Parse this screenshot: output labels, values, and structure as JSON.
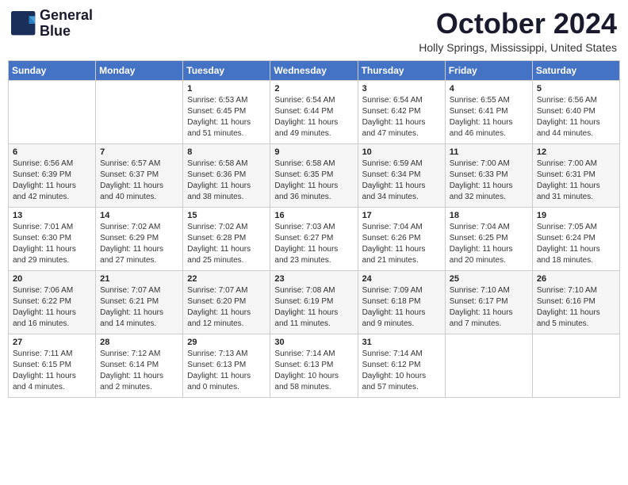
{
  "header": {
    "logo_line1": "General",
    "logo_line2": "Blue",
    "month_title": "October 2024",
    "location": "Holly Springs, Mississippi, United States"
  },
  "weekdays": [
    "Sunday",
    "Monday",
    "Tuesday",
    "Wednesday",
    "Thursday",
    "Friday",
    "Saturday"
  ],
  "weeks": [
    [
      {
        "day": "",
        "info": ""
      },
      {
        "day": "",
        "info": ""
      },
      {
        "day": "1",
        "info": "Sunrise: 6:53 AM\nSunset: 6:45 PM\nDaylight: 11 hours and 51 minutes."
      },
      {
        "day": "2",
        "info": "Sunrise: 6:54 AM\nSunset: 6:44 PM\nDaylight: 11 hours and 49 minutes."
      },
      {
        "day": "3",
        "info": "Sunrise: 6:54 AM\nSunset: 6:42 PM\nDaylight: 11 hours and 47 minutes."
      },
      {
        "day": "4",
        "info": "Sunrise: 6:55 AM\nSunset: 6:41 PM\nDaylight: 11 hours and 46 minutes."
      },
      {
        "day": "5",
        "info": "Sunrise: 6:56 AM\nSunset: 6:40 PM\nDaylight: 11 hours and 44 minutes."
      }
    ],
    [
      {
        "day": "6",
        "info": "Sunrise: 6:56 AM\nSunset: 6:39 PM\nDaylight: 11 hours and 42 minutes."
      },
      {
        "day": "7",
        "info": "Sunrise: 6:57 AM\nSunset: 6:37 PM\nDaylight: 11 hours and 40 minutes."
      },
      {
        "day": "8",
        "info": "Sunrise: 6:58 AM\nSunset: 6:36 PM\nDaylight: 11 hours and 38 minutes."
      },
      {
        "day": "9",
        "info": "Sunrise: 6:58 AM\nSunset: 6:35 PM\nDaylight: 11 hours and 36 minutes."
      },
      {
        "day": "10",
        "info": "Sunrise: 6:59 AM\nSunset: 6:34 PM\nDaylight: 11 hours and 34 minutes."
      },
      {
        "day": "11",
        "info": "Sunrise: 7:00 AM\nSunset: 6:33 PM\nDaylight: 11 hours and 32 minutes."
      },
      {
        "day": "12",
        "info": "Sunrise: 7:00 AM\nSunset: 6:31 PM\nDaylight: 11 hours and 31 minutes."
      }
    ],
    [
      {
        "day": "13",
        "info": "Sunrise: 7:01 AM\nSunset: 6:30 PM\nDaylight: 11 hours and 29 minutes."
      },
      {
        "day": "14",
        "info": "Sunrise: 7:02 AM\nSunset: 6:29 PM\nDaylight: 11 hours and 27 minutes."
      },
      {
        "day": "15",
        "info": "Sunrise: 7:02 AM\nSunset: 6:28 PM\nDaylight: 11 hours and 25 minutes."
      },
      {
        "day": "16",
        "info": "Sunrise: 7:03 AM\nSunset: 6:27 PM\nDaylight: 11 hours and 23 minutes."
      },
      {
        "day": "17",
        "info": "Sunrise: 7:04 AM\nSunset: 6:26 PM\nDaylight: 11 hours and 21 minutes."
      },
      {
        "day": "18",
        "info": "Sunrise: 7:04 AM\nSunset: 6:25 PM\nDaylight: 11 hours and 20 minutes."
      },
      {
        "day": "19",
        "info": "Sunrise: 7:05 AM\nSunset: 6:24 PM\nDaylight: 11 hours and 18 minutes."
      }
    ],
    [
      {
        "day": "20",
        "info": "Sunrise: 7:06 AM\nSunset: 6:22 PM\nDaylight: 11 hours and 16 minutes."
      },
      {
        "day": "21",
        "info": "Sunrise: 7:07 AM\nSunset: 6:21 PM\nDaylight: 11 hours and 14 minutes."
      },
      {
        "day": "22",
        "info": "Sunrise: 7:07 AM\nSunset: 6:20 PM\nDaylight: 11 hours and 12 minutes."
      },
      {
        "day": "23",
        "info": "Sunrise: 7:08 AM\nSunset: 6:19 PM\nDaylight: 11 hours and 11 minutes."
      },
      {
        "day": "24",
        "info": "Sunrise: 7:09 AM\nSunset: 6:18 PM\nDaylight: 11 hours and 9 minutes."
      },
      {
        "day": "25",
        "info": "Sunrise: 7:10 AM\nSunset: 6:17 PM\nDaylight: 11 hours and 7 minutes."
      },
      {
        "day": "26",
        "info": "Sunrise: 7:10 AM\nSunset: 6:16 PM\nDaylight: 11 hours and 5 minutes."
      }
    ],
    [
      {
        "day": "27",
        "info": "Sunrise: 7:11 AM\nSunset: 6:15 PM\nDaylight: 11 hours and 4 minutes."
      },
      {
        "day": "28",
        "info": "Sunrise: 7:12 AM\nSunset: 6:14 PM\nDaylight: 11 hours and 2 minutes."
      },
      {
        "day": "29",
        "info": "Sunrise: 7:13 AM\nSunset: 6:13 PM\nDaylight: 11 hours and 0 minutes."
      },
      {
        "day": "30",
        "info": "Sunrise: 7:14 AM\nSunset: 6:13 PM\nDaylight: 10 hours and 58 minutes."
      },
      {
        "day": "31",
        "info": "Sunrise: 7:14 AM\nSunset: 6:12 PM\nDaylight: 10 hours and 57 minutes."
      },
      {
        "day": "",
        "info": ""
      },
      {
        "day": "",
        "info": ""
      }
    ]
  ]
}
